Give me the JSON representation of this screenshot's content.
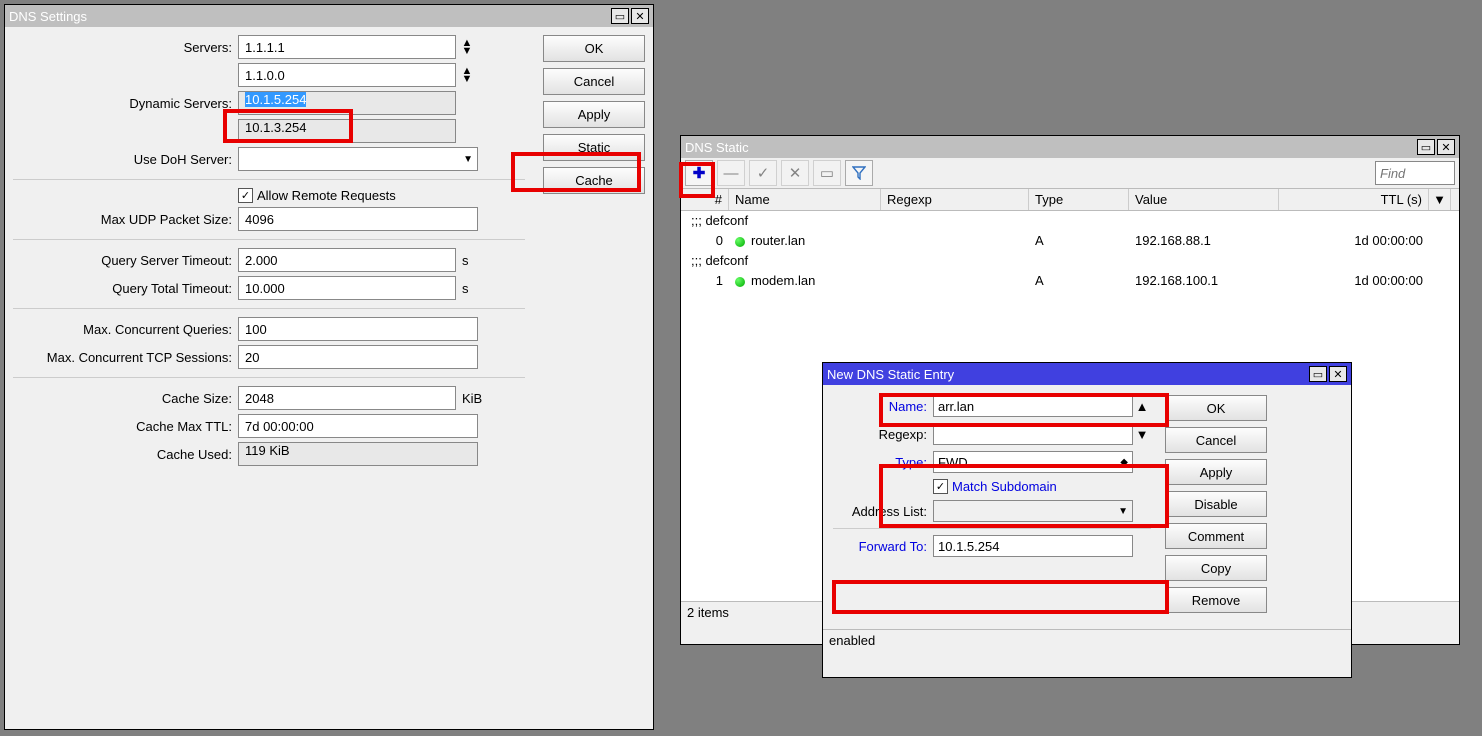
{
  "dns_settings": {
    "title": "DNS Settings",
    "labels": {
      "servers": "Servers:",
      "dynamic_servers": "Dynamic Servers:",
      "use_doh": "Use DoH Server:",
      "allow_remote": "Allow Remote Requests",
      "max_udp": "Max UDP Packet Size:",
      "query_server_timeout": "Query Server Timeout:",
      "query_total_timeout": "Query Total Timeout:",
      "max_concurrent_queries": "Max. Concurrent Queries:",
      "max_concurrent_tcp": "Max. Concurrent TCP Sessions:",
      "cache_size": "Cache Size:",
      "cache_max_ttl": "Cache Max TTL:",
      "cache_used": "Cache Used:"
    },
    "servers": [
      "1.1.1.1",
      "1.1.0.0"
    ],
    "dynamic_servers": [
      "10.1.5.254",
      "10.1.3.254"
    ],
    "use_doh_server": "",
    "allow_remote_requests": true,
    "max_udp_packet_size": "4096",
    "query_server_timeout": "2.000",
    "query_total_timeout": "10.000",
    "max_concurrent_queries": "100",
    "max_concurrent_tcp": "20",
    "cache_size": "2048",
    "cache_max_ttl": "7d 00:00:00",
    "cache_used": "119 KiB",
    "units": {
      "seconds": "s",
      "kib": "KiB"
    },
    "buttons": {
      "ok": "OK",
      "cancel": "Cancel",
      "apply": "Apply",
      "static": "Static",
      "cache": "Cache"
    }
  },
  "dns_static": {
    "title": "DNS Static",
    "find_placeholder": "Find",
    "columns": {
      "num": "#",
      "name": "Name",
      "regexp": "Regexp",
      "type": "Type",
      "value": "Value",
      "ttl": "TTL (s)"
    },
    "entries": [
      {
        "comment": ";;; defconf",
        "index": "0",
        "name": "router.lan",
        "type": "A",
        "value": "192.168.88.1",
        "ttl": "1d 00:00:00"
      },
      {
        "comment": ";;; defconf",
        "index": "1",
        "name": "modem.lan",
        "type": "A",
        "value": "192.168.100.1",
        "ttl": "1d 00:00:00"
      }
    ],
    "status": "2 items"
  },
  "new_entry": {
    "title": "New DNS Static Entry",
    "labels": {
      "name": "Name:",
      "regexp": "Regexp:",
      "type": "Type:",
      "match_subdomain": "Match Subdomain",
      "address_list": "Address List:",
      "forward_to": "Forward To:"
    },
    "values": {
      "name": "arr.lan",
      "regexp": "",
      "type": "FWD",
      "match_subdomain": true,
      "address_list": "",
      "forward_to": "10.1.5.254"
    },
    "buttons": {
      "ok": "OK",
      "cancel": "Cancel",
      "apply": "Apply",
      "disable": "Disable",
      "comment": "Comment",
      "copy": "Copy",
      "remove": "Remove"
    },
    "status": "enabled"
  }
}
